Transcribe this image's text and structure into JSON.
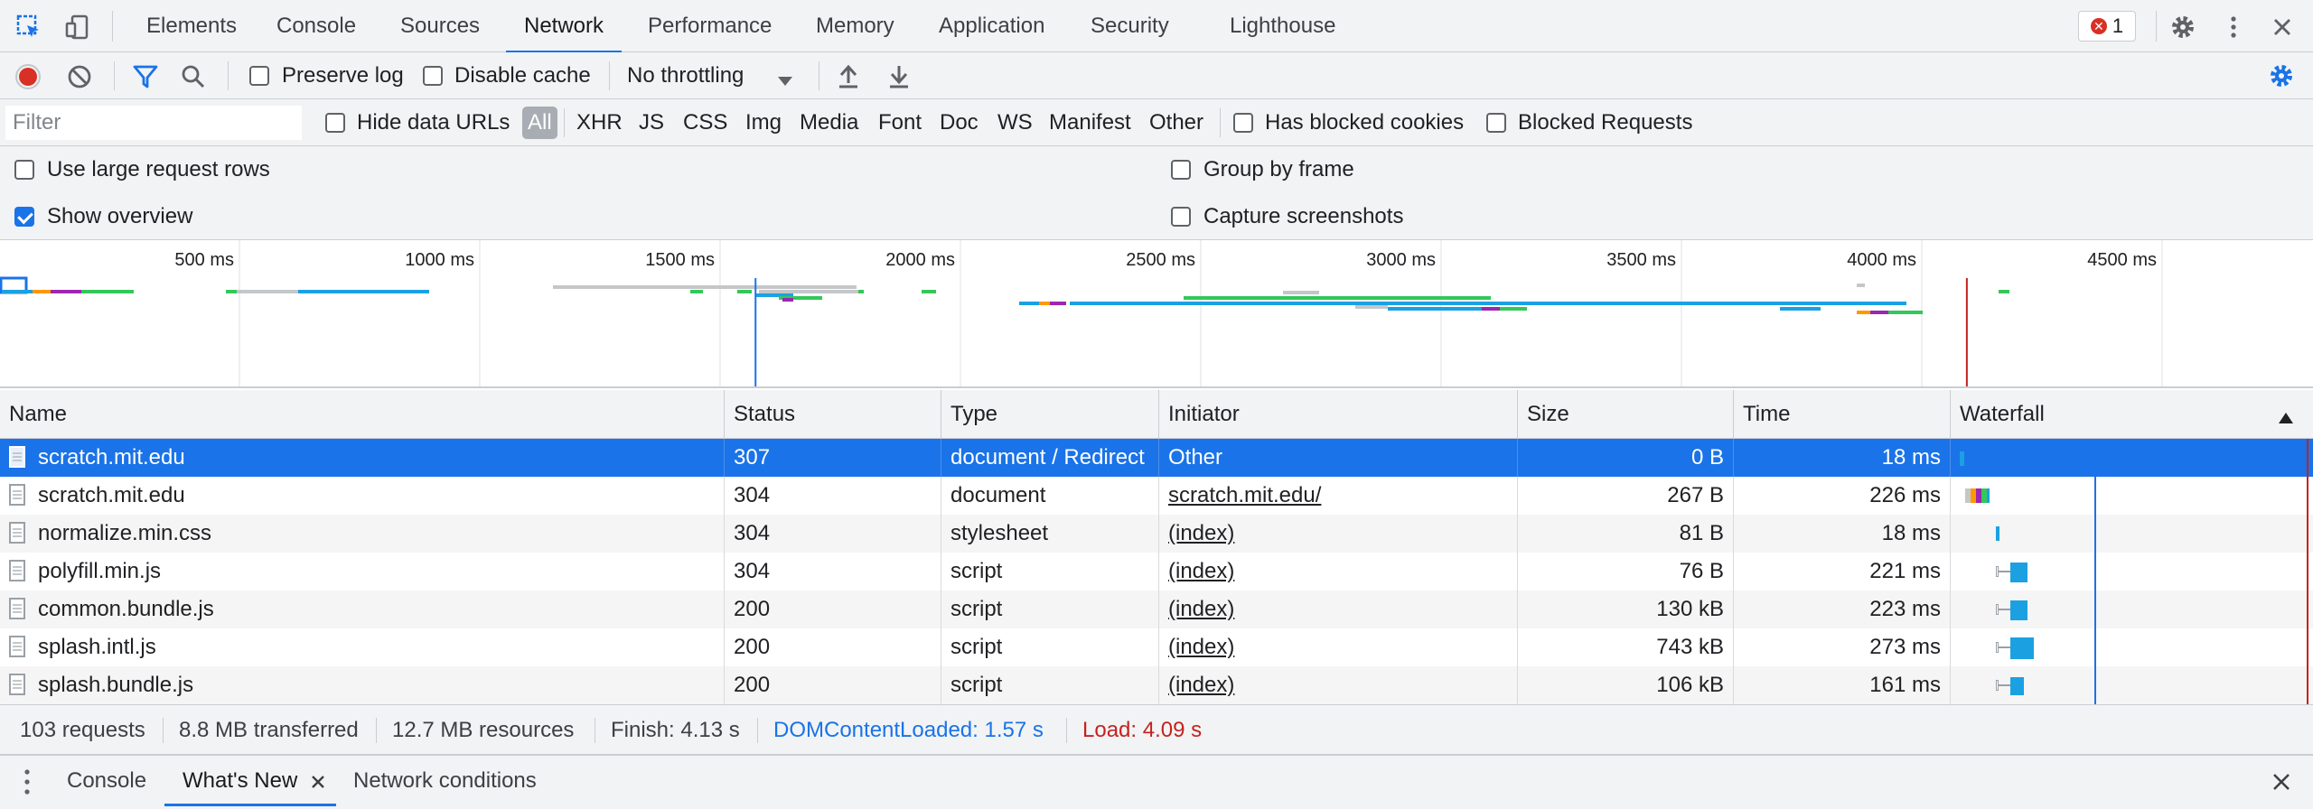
{
  "toolbar_tabs": [
    {
      "label": "Elements"
    },
    {
      "label": "Console"
    },
    {
      "label": "Sources"
    },
    {
      "label": "Network"
    },
    {
      "label": "Performance"
    },
    {
      "label": "Memory"
    },
    {
      "label": "Application"
    },
    {
      "label": "Security"
    },
    {
      "label": "Lighthouse"
    }
  ],
  "active_tab": "Network",
  "error_count": "1",
  "network_toolbar": {
    "preserve_log_label": "Preserve log",
    "disable_cache_label": "Disable cache",
    "throttling_value": "No throttling",
    "preserve_log_checked": false,
    "disable_cache_checked": false
  },
  "filter_bar": {
    "placeholder": "Filter",
    "hide_data_urls_label": "Hide data URLs",
    "types": [
      "All",
      "XHR",
      "JS",
      "CSS",
      "Img",
      "Media",
      "Font",
      "Doc",
      "WS",
      "Manifest",
      "Other"
    ],
    "has_blocked_cookies_label": "Has blocked cookies",
    "blocked_requests_label": "Blocked Requests"
  },
  "settings": {
    "use_large_rows_label": "Use large request rows",
    "show_overview_label": "Show overview",
    "group_by_frame_label": "Group by frame",
    "capture_screenshots_label": "Capture screenshots",
    "show_overview_checked": true
  },
  "overview": {
    "tick_labels": [
      "500 ms",
      "1000 ms",
      "1500 ms",
      "2000 ms",
      "2500 ms",
      "3000 ms",
      "3500 ms",
      "4000 ms",
      "4500 ms"
    ],
    "dom_content_loaded_ms": 1570,
    "load_ms": 4090
  },
  "table": {
    "columns": [
      "Name",
      "Status",
      "Type",
      "Initiator",
      "Size",
      "Time",
      "Waterfall"
    ],
    "rows": [
      {
        "name": "scratch.mit.edu",
        "status": "307",
        "type": "document / Redirect",
        "initiator": "Other",
        "initiator_link": false,
        "size": "0 B",
        "time": "18 ms",
        "selected": true
      },
      {
        "name": "scratch.mit.edu",
        "status": "304",
        "type": "document",
        "initiator": "scratch.mit.edu/",
        "initiator_link": true,
        "size": "267 B",
        "time": "226 ms",
        "selected": false
      },
      {
        "name": "normalize.min.css",
        "status": "304",
        "type": "stylesheet",
        "initiator": "(index)",
        "initiator_link": true,
        "size": "81 B",
        "time": "18 ms",
        "selected": false
      },
      {
        "name": "polyfill.min.js",
        "status": "304",
        "type": "script",
        "initiator": "(index)",
        "initiator_link": true,
        "size": "76 B",
        "time": "221 ms",
        "selected": false
      },
      {
        "name": "common.bundle.js",
        "status": "200",
        "type": "script",
        "initiator": "(index)",
        "initiator_link": true,
        "size": "130 kB",
        "time": "223 ms",
        "selected": false
      },
      {
        "name": "splash.intl.js",
        "status": "200",
        "type": "script",
        "initiator": "(index)",
        "initiator_link": true,
        "size": "743 kB",
        "time": "273 ms",
        "selected": false
      },
      {
        "name": "splash.bundle.js",
        "status": "200",
        "type": "script",
        "initiator": "(index)",
        "initiator_link": true,
        "size": "106 kB",
        "time": "161 ms",
        "selected": false
      }
    ]
  },
  "summary": {
    "requests": "103 requests",
    "transferred": "8.8 MB transferred",
    "resources": "12.7 MB resources",
    "finish": "Finish: 4.13 s",
    "dom_content_loaded": "DOMContentLoaded: 1.57 s",
    "load": "Load: 4.09 s",
    "dcl_color": "#1a73e8",
    "load_color": "#c5221f"
  },
  "drawer": {
    "tabs": [
      {
        "label": "Console"
      },
      {
        "label": "What's New"
      },
      {
        "label": "Network conditions"
      }
    ],
    "active_tab": "What's New"
  },
  "colors": {
    "accent": "#1a73e8",
    "record_red": "#d93025",
    "selected_row": "#1a73e8",
    "waterfall_blue": "#1ba1e2"
  }
}
